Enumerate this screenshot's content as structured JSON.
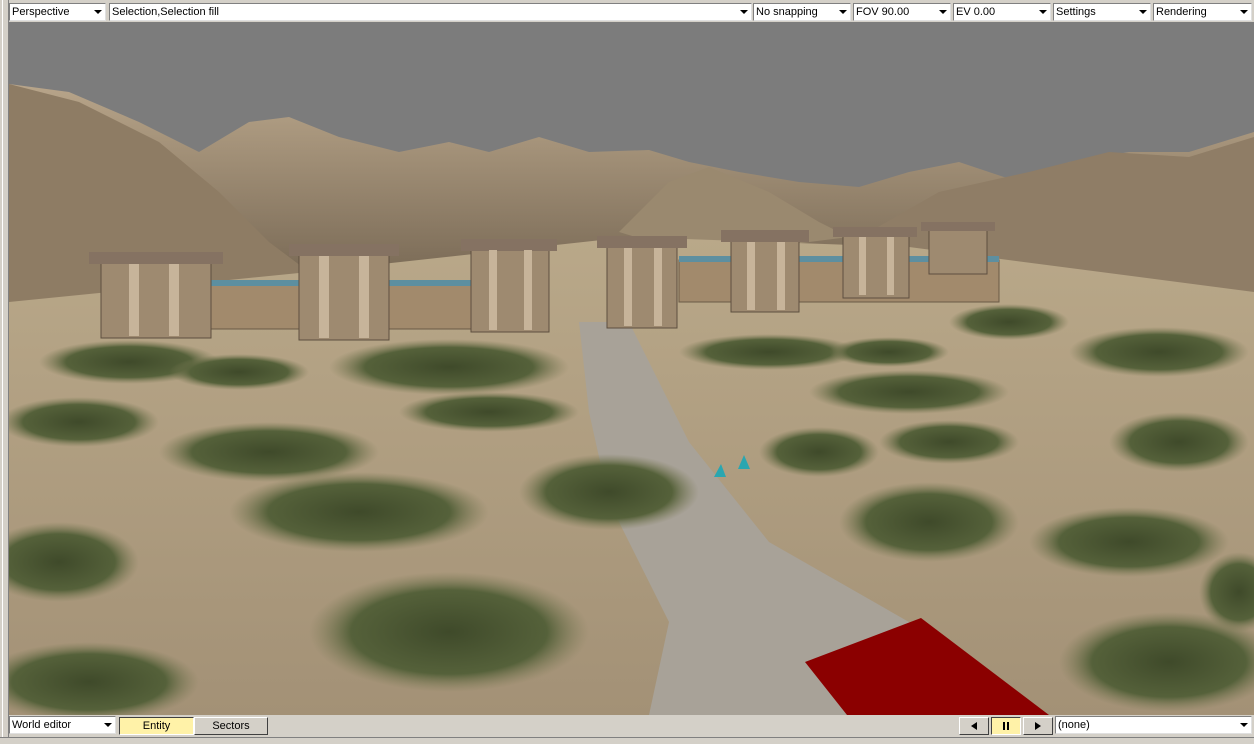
{
  "toolbar": {
    "view_mode": "Perspective",
    "selection_mode": "Selection,Selection fill",
    "snapping": "No snapping",
    "fov": "FOV 90.00",
    "ev": "EV  0.00",
    "settings": "Settings",
    "rendering": "Rendering"
  },
  "bottom_bar": {
    "editor_mode": "World editor",
    "tab_entity": "Entity",
    "tab_sectors": "Sectors",
    "selection_value": "(none)"
  },
  "colors": {
    "sky": "#7c7c7c",
    "selected_tab": "#fff2a8",
    "red_object": "#8b0000",
    "marker": "#2aa6b0"
  },
  "icons": {
    "prev": "triangle-left-icon",
    "pause": "pause-icon",
    "next": "triangle-right-icon"
  }
}
